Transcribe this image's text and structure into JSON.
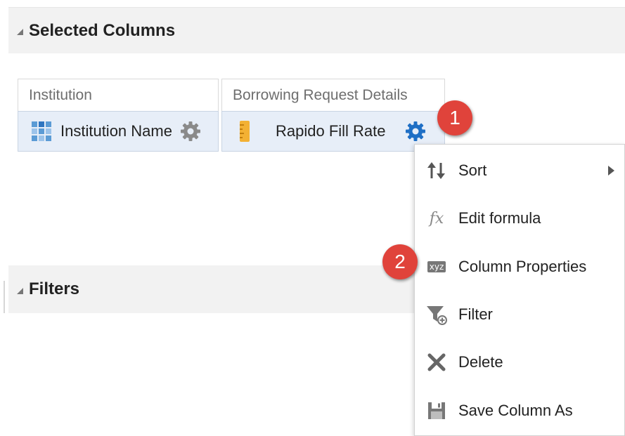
{
  "sections": {
    "selected_columns_title": "Selected Columns",
    "filters_title": "Filters"
  },
  "columns": [
    {
      "header": "Institution",
      "cell_label": "Institution Name",
      "cell_icon": "table-icon",
      "settings_icon": "gear-icon"
    },
    {
      "header": "Borrowing Request Details",
      "cell_label": "Rapido Fill Rate",
      "cell_icon": "ruler-icon",
      "settings_icon": "gear-icon"
    }
  ],
  "callouts": [
    "1",
    "2"
  ],
  "context_menu": {
    "items": [
      {
        "label": "Sort",
        "icon": "sort-icon",
        "has_submenu": true
      },
      {
        "label": "Edit formula",
        "icon": "fx-icon",
        "icon_text": "fx"
      },
      {
        "label": "Column Properties",
        "icon": "xyz-icon",
        "icon_text": "xyz"
      },
      {
        "label": "Filter",
        "icon": "filter-icon"
      },
      {
        "label": "Delete",
        "icon": "delete-icon"
      },
      {
        "label": "Save Column As",
        "icon": "save-icon"
      }
    ]
  },
  "colors": {
    "callout": "#e0433b",
    "active_gear": "#1f6fc5",
    "inactive_gear": "#8a8a8a",
    "cell_background": "#e7eef8",
    "section_header_background": "#f2f2f2"
  }
}
